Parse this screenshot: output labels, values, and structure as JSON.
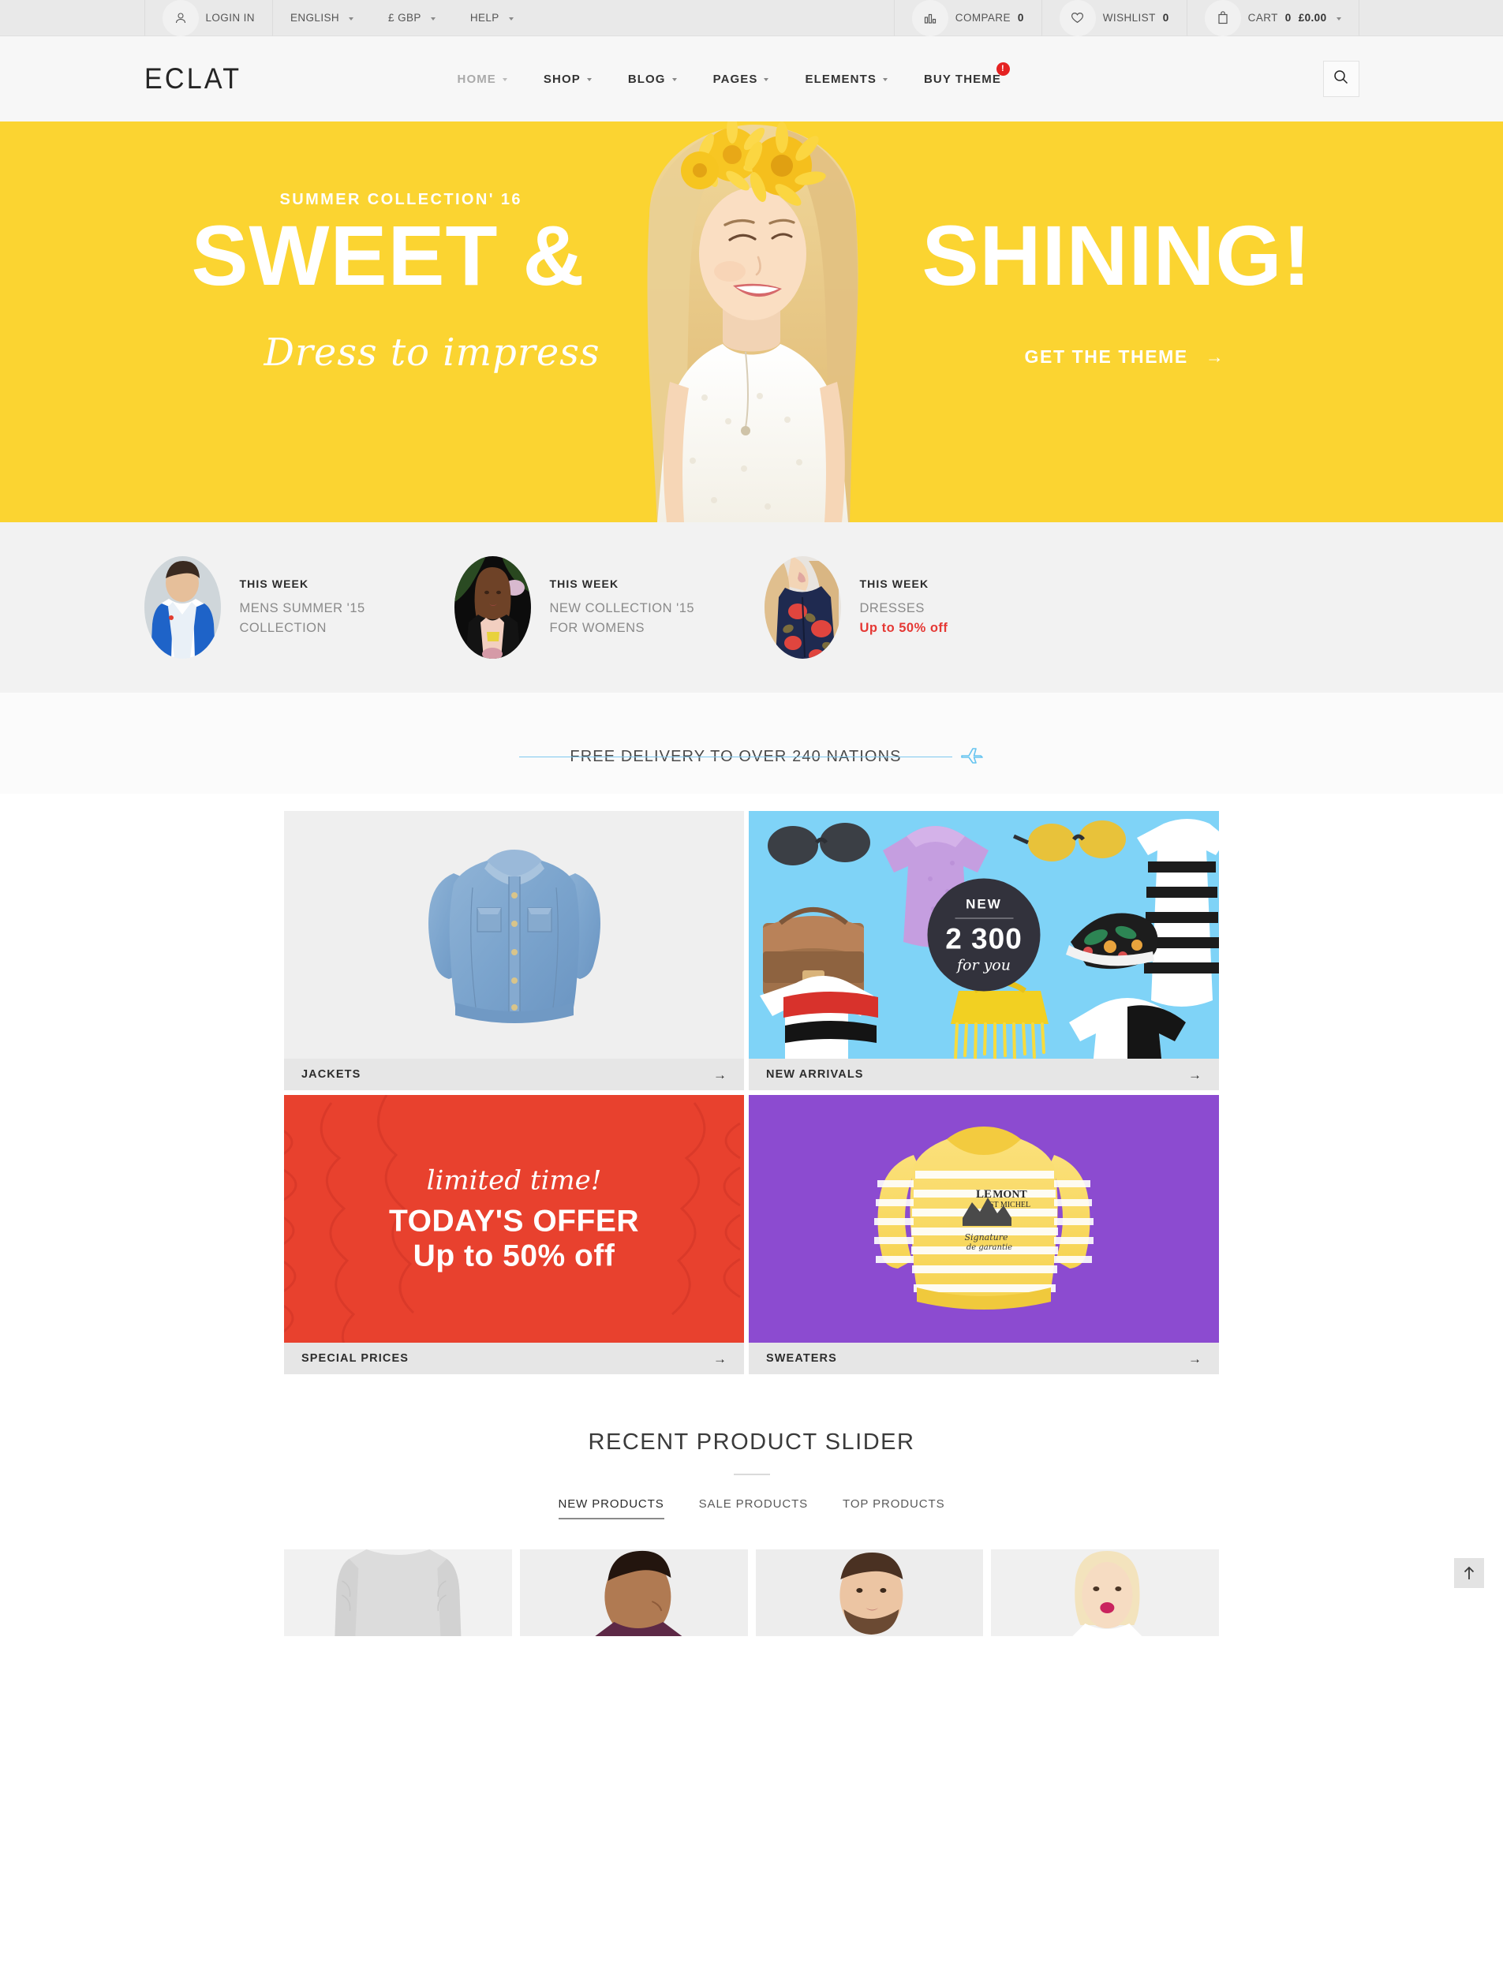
{
  "topbar": {
    "login": "LOGIN IN",
    "language": "ENGLISH",
    "currency": "£ GBP",
    "help": "HELP",
    "compare_label": "COMPARE",
    "compare_count": "0",
    "wishlist_label": "WISHLIST",
    "wishlist_count": "0",
    "cart_label": "CART",
    "cart_count": "0",
    "cart_total": "£0.00"
  },
  "header": {
    "logo": "ECLAT",
    "nav": [
      {
        "label": "HOME",
        "has_caret": true,
        "active": true
      },
      {
        "label": "SHOP",
        "has_caret": true,
        "active": false
      },
      {
        "label": "BLOG",
        "has_caret": true,
        "active": false
      },
      {
        "label": "PAGES",
        "has_caret": true,
        "active": false
      },
      {
        "label": "ELEMENTS",
        "has_caret": true,
        "active": false
      },
      {
        "label": "BUY THEME",
        "has_caret": false,
        "active": false,
        "badge": "!"
      }
    ],
    "search_icon": "search-icon"
  },
  "hero": {
    "kicker": "SUMMER COLLECTION' 16",
    "title_left": "SWEET &",
    "title_right": "SHINING!",
    "script": "Dress to impress",
    "cta": "GET THE THEME",
    "cta_arrow": "→",
    "bg_color": "#fbd431"
  },
  "promos": [
    {
      "week": "THIS WEEK",
      "line1": "MENS SUMMER '15",
      "line2": "COLLECTION",
      "accent": false
    },
    {
      "week": "THIS WEEK",
      "line1": "NEW COLLECTION '15",
      "line2": "FOR WOMENS",
      "accent": false
    },
    {
      "week": "THIS WEEK",
      "line1": "DRESSES",
      "line2": "Up to 50% off",
      "accent": true
    }
  ],
  "delivery": {
    "text": "FREE DELIVERY TO OVER 240 NATIONS",
    "icon": "airplane-icon",
    "line_color": "#7ec8ef"
  },
  "tiles": [
    {
      "label": "JACKETS",
      "arrow": "→"
    },
    {
      "label": "NEW ARRIVALS",
      "arrow": "→"
    },
    {
      "label": "SPECIAL PRICES",
      "arrow": "→"
    },
    {
      "label": "SWEATERS",
      "arrow": "→"
    }
  ],
  "new_badge": {
    "top": "NEW",
    "number": "2 300",
    "bottom": "for you"
  },
  "offer": {
    "script": "limited time!",
    "line1": "TODAY'S OFFER",
    "line2": "Up to 50% off",
    "bg_color": "#e8412e"
  },
  "slider": {
    "title": "RECENT PRODUCT SLIDER",
    "tabs": [
      {
        "label": "NEW PRODUCTS",
        "active": true
      },
      {
        "label": "SALE PRODUCTS",
        "active": false
      },
      {
        "label": "TOP PRODUCTS",
        "active": false
      }
    ]
  },
  "scroll_top": {
    "icon": "arrow-up-icon"
  }
}
